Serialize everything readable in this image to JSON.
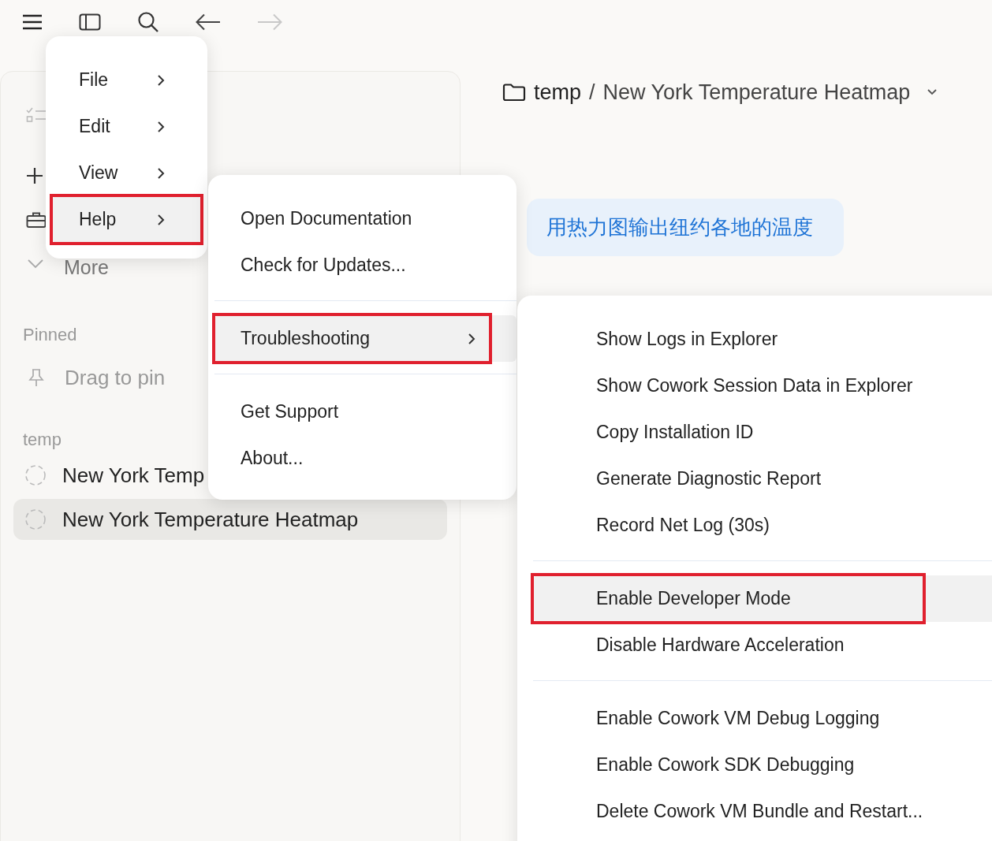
{
  "nav": {
    "back_disabled": false,
    "forward_disabled": true
  },
  "sidebar": {
    "more_label": "More",
    "pinned_heading": "Pinned",
    "pin_hint": "Drag to pin",
    "project_heading": "temp",
    "chats": [
      {
        "title": "New York Temp",
        "selected": false
      },
      {
        "title": "New York Temperature Heatmap",
        "selected": true
      }
    ]
  },
  "breadcrumb": {
    "folder": "temp",
    "separator": "/",
    "title": "New York Temperature Heatmap"
  },
  "message": "用热力图输出纽约各地的温度",
  "app_menu": {
    "items": [
      {
        "label": "File",
        "selected": false,
        "highlighted": false
      },
      {
        "label": "Edit",
        "selected": false,
        "highlighted": false
      },
      {
        "label": "View",
        "selected": false,
        "highlighted": false
      },
      {
        "label": "Help",
        "selected": true,
        "highlighted": true
      }
    ]
  },
  "help_menu": {
    "groups": [
      [
        {
          "label": "Open Documentation",
          "submenu": false,
          "selected": false,
          "highlighted": false
        },
        {
          "label": "Check for Updates...",
          "submenu": false,
          "selected": false,
          "highlighted": false
        }
      ],
      [
        {
          "label": "Troubleshooting",
          "submenu": true,
          "selected": true,
          "highlighted": true
        }
      ],
      [
        {
          "label": "Get Support",
          "submenu": false,
          "selected": false,
          "highlighted": false
        },
        {
          "label": "About...",
          "submenu": false,
          "selected": false,
          "highlighted": false
        }
      ]
    ]
  },
  "troubleshooting_menu": {
    "groups": [
      [
        {
          "label": "Show Logs in Explorer",
          "selected": false,
          "highlighted": false
        },
        {
          "label": "Show Cowork Session Data in Explorer",
          "selected": false,
          "highlighted": false
        },
        {
          "label": "Copy Installation ID",
          "selected": false,
          "highlighted": false
        },
        {
          "label": "Generate Diagnostic Report",
          "selected": false,
          "highlighted": false
        },
        {
          "label": "Record Net Log (30s)",
          "selected": false,
          "highlighted": false
        }
      ],
      [
        {
          "label": "Enable Developer Mode",
          "selected": true,
          "highlighted": true
        },
        {
          "label": "Disable Hardware Acceleration",
          "selected": false,
          "highlighted": false
        }
      ],
      [
        {
          "label": "Enable Cowork VM Debug Logging",
          "selected": false,
          "highlighted": false
        },
        {
          "label": "Enable Cowork SDK Debugging",
          "selected": false,
          "highlighted": false
        },
        {
          "label": "Delete Cowork VM Bundle and Restart...",
          "selected": false,
          "highlighted": false
        }
      ]
    ]
  }
}
